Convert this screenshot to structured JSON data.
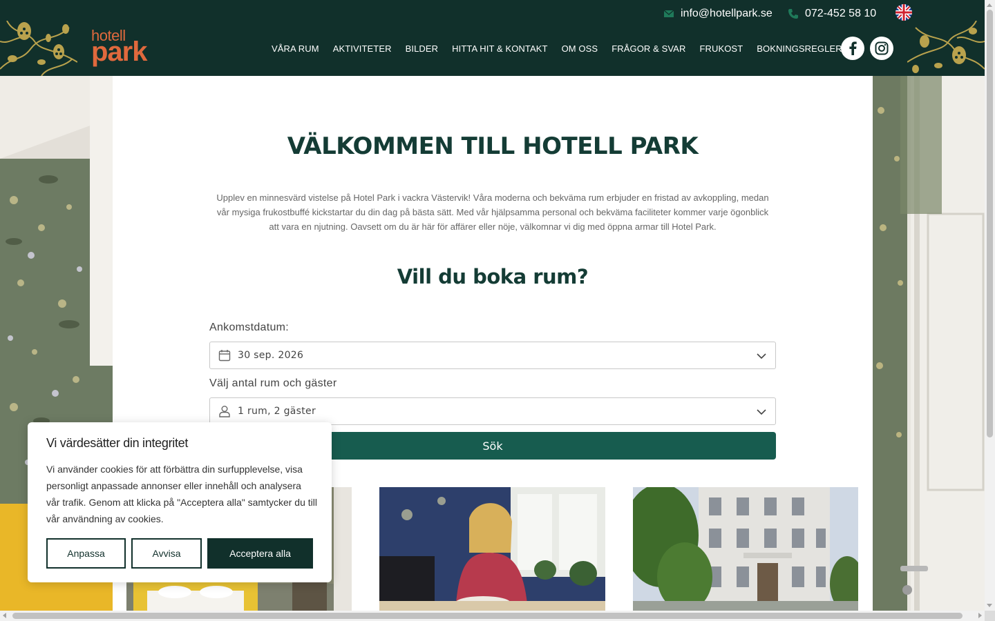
{
  "brand": {
    "logo_line1": "hotell",
    "logo_line2": "park",
    "primary_color": "#11302b",
    "accent_color": "#e0693d",
    "button_color": "#175c4f"
  },
  "topbar": {
    "email": "info@hotellpark.se",
    "phone": "072-452 58 10",
    "email_icon": "envelope-icon",
    "phone_icon": "phone-icon",
    "language_icon": "uk-flag-icon"
  },
  "nav": {
    "items": [
      {
        "label": "VÅRA RUM"
      },
      {
        "label": "AKTIVITETER"
      },
      {
        "label": "BILDER"
      },
      {
        "label": "HITTA HIT & KONTAKT"
      },
      {
        "label": "OM OSS"
      },
      {
        "label": "FRÅGOR & SVAR"
      },
      {
        "label": "FRUKOST"
      },
      {
        "label": "BOKNINGSREGLER"
      }
    ],
    "social_icons": [
      "facebook-icon",
      "instagram-icon"
    ]
  },
  "main": {
    "title": "VÄLKOMMEN TILL HOTELL PARK",
    "intro": "Upplev en minnesvärd vistelse på Hotel Park i vackra Västervik! Våra moderna och bekväma rum erbjuder en fristad av avkoppling, medan vår mysiga frukostbuffé kickstartar du din dag på bästa sätt. Med vår hjälpsamma personal och bekväma faciliteter kommer varje ögonblick att vara en njutning. Oavsett om du är här för affärer eller nöje, välkomnar vi dig med öppna armar till Hotel Park.",
    "booking_title": "Vill du boka rum?"
  },
  "booking": {
    "arrival_label": "Ankomstdatum:",
    "arrival_value": "30 sep. 2026",
    "guests_label": "Välj antal rum och gäster",
    "guests_value": "1 rum, 2 gäster",
    "search_label": "Sök"
  },
  "cookie": {
    "title": "Vi värdesätter din integritet",
    "text": "Vi använder cookies för att förbättra din surfupplevelse, visa personligt anpassade annonser eller innehåll och analysera vår trafik. Genom att klicka på \"Acceptera alla\" samtycker du till vår användning av cookies.",
    "customize_label": "Anpassa",
    "reject_label": "Avvisa",
    "accept_label": "Acceptera alla"
  }
}
